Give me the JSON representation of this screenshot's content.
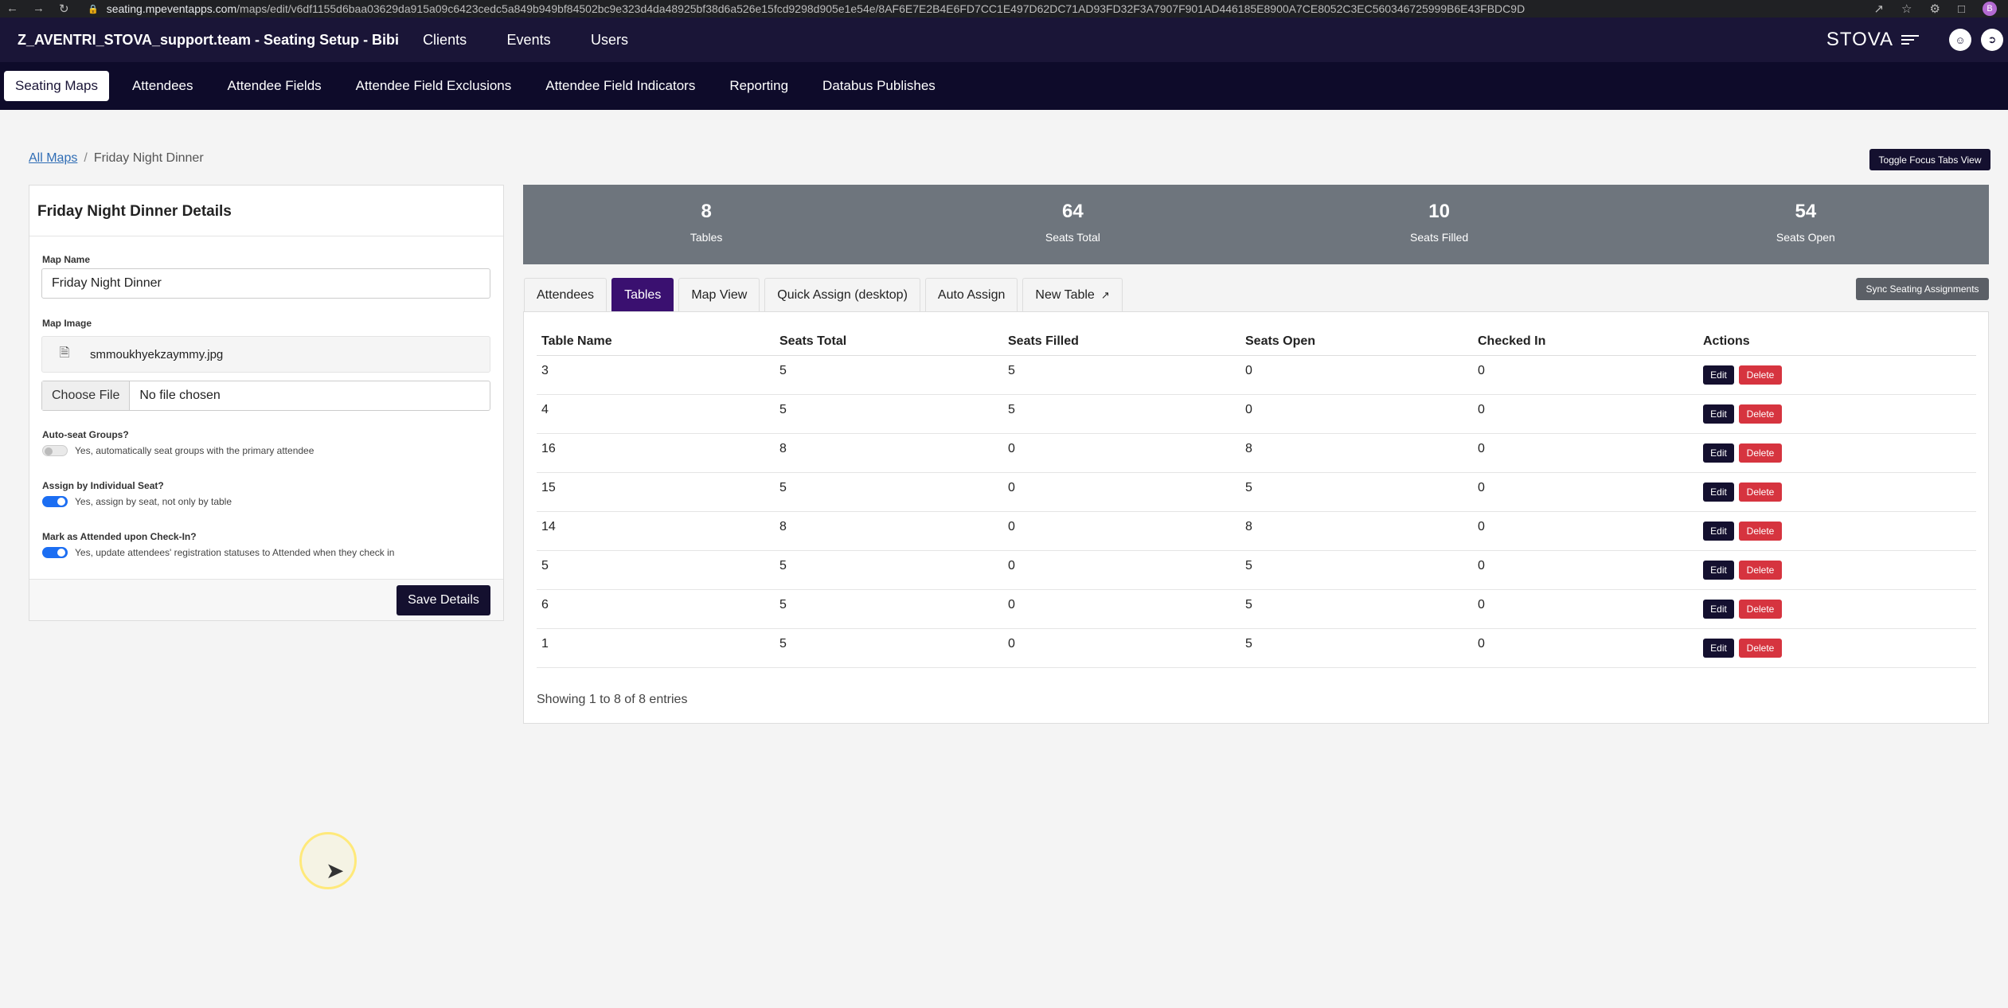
{
  "browser": {
    "url_domain": "seating.mpeventapps.com",
    "url_path": "/maps/edit/v6df1155d6baa03629da915a09c6423cedc5a849b949bf84502bc9e323d4da48925bf38d6a526e15fcd9298d905e1e54e/8AF6E7E2B4E6FD7CC1E497D62DC71AD93FD32F3A7907F901AD446185E8900A7CE8052C3EC560346725999B6E43FBDC9D",
    "profile_initial": "B"
  },
  "header": {
    "title": "Z_AVENTRI_STOVA_support.team - Seating Setup - Bibi",
    "nav": [
      "Clients",
      "Events",
      "Users"
    ],
    "brand": "STOVA"
  },
  "subnav": {
    "tabs": [
      "Seating Maps",
      "Attendees",
      "Attendee Fields",
      "Attendee Field Exclusions",
      "Attendee Field Indicators",
      "Reporting",
      "Databus Publishes"
    ],
    "active": "Seating Maps"
  },
  "breadcrumb": {
    "root": "All Maps",
    "current": "Friday Night Dinner"
  },
  "toggle_focus_label": "Toggle Focus Tabs View",
  "details": {
    "heading": "Friday Night Dinner Details",
    "map_name_label": "Map Name",
    "map_name_value": "Friday Night Dinner",
    "map_image_label": "Map Image",
    "map_image_file": "smmoukhyekzaymmy.jpg",
    "choose_file_label": "Choose File",
    "no_file_label": "No file chosen",
    "auto_seat_label": "Auto-seat Groups?",
    "auto_seat_text": "Yes, automatically seat groups with the primary attendee",
    "auto_seat_on": false,
    "assign_seat_label": "Assign by Individual Seat?",
    "assign_seat_text": "Yes, assign by seat, not only by table",
    "assign_seat_on": true,
    "mark_attended_label": "Mark as Attended upon Check-In?",
    "mark_attended_text": "Yes, update attendees' registration statuses to Attended when they check in",
    "mark_attended_on": true,
    "save_label": "Save Details"
  },
  "stats": [
    {
      "value": "8",
      "label": "Tables"
    },
    {
      "value": "64",
      "label": "Seats Total"
    },
    {
      "value": "10",
      "label": "Seats Filled"
    },
    {
      "value": "54",
      "label": "Seats Open"
    }
  ],
  "tabs": {
    "items": [
      "Attendees",
      "Tables",
      "Map View",
      "Quick Assign (desktop)",
      "Auto Assign",
      "New Table"
    ],
    "active": "Tables"
  },
  "sync_label": "Sync Seating Assignments",
  "table": {
    "columns": [
      "Table Name",
      "Seats Total",
      "Seats Filled",
      "Seats Open",
      "Checked In",
      "Actions"
    ],
    "rows": [
      [
        "3",
        "5",
        "5",
        "0",
        "0"
      ],
      [
        "4",
        "5",
        "5",
        "0",
        "0"
      ],
      [
        "16",
        "8",
        "0",
        "8",
        "0"
      ],
      [
        "15",
        "5",
        "0",
        "5",
        "0"
      ],
      [
        "14",
        "8",
        "0",
        "8",
        "0"
      ],
      [
        "5",
        "5",
        "0",
        "5",
        "0"
      ],
      [
        "6",
        "5",
        "0",
        "5",
        "0"
      ],
      [
        "1",
        "5",
        "0",
        "5",
        "0"
      ]
    ],
    "edit_label": "Edit",
    "delete_label": "Delete",
    "footer": "Showing 1 to 8 of 8 entries"
  },
  "colors": {
    "header_bg": "#1a1537",
    "subnav_bg": "#0e0b2a",
    "active_tab": "#3a1070",
    "stats_bg": "#6e757d",
    "delete": "#d6343f",
    "toggle_on": "#1c6ef2"
  },
  "icons": [
    "back-arrow-icon",
    "forward-arrow-icon",
    "reload-icon",
    "lock-icon",
    "share-icon",
    "star-icon",
    "puzzle-icon",
    "sidebar-icon",
    "file-icon",
    "external-link-icon",
    "user-icon",
    "logout-icon"
  ]
}
